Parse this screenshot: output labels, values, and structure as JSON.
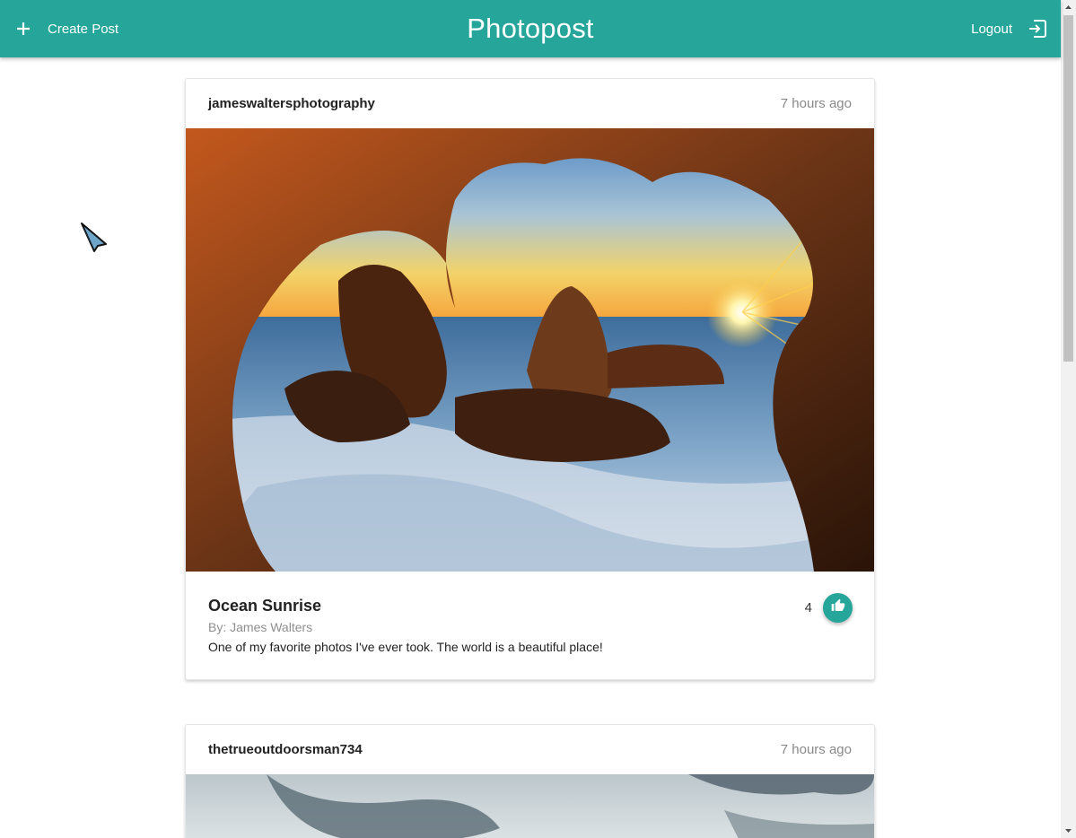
{
  "header": {
    "create_label": "Create Post",
    "title": "Photopost",
    "logout_label": "Logout",
    "brand_color": "#26a69a"
  },
  "posts": [
    {
      "username": "jameswaltersphotography",
      "time": "7 hours ago",
      "title": "Ocean Sunrise",
      "author": "By: James Walters",
      "description": "One of my favorite photos I've ever took. The world is a beautiful place!",
      "likes": "4"
    },
    {
      "username": "thetrueoutdoorsman734",
      "time": "7 hours ago"
    }
  ],
  "icons": {
    "create": "plus-icon",
    "logout": "logout-icon",
    "like": "thumb-up-icon"
  }
}
